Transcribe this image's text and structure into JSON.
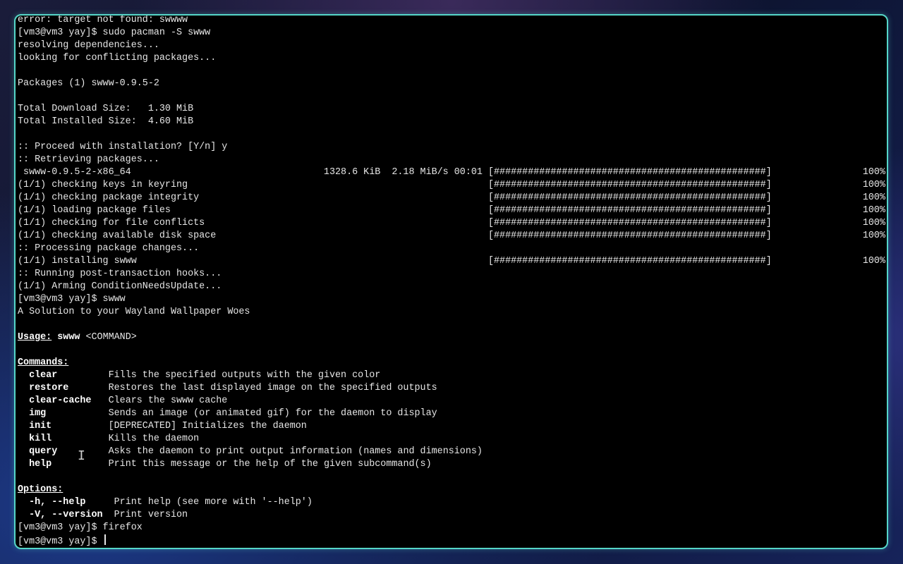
{
  "terminal": {
    "lines": [
      "error: target not found: swwww",
      "[vm3@vm3 yay]$ sudo pacman -S swww",
      "resolving dependencies...",
      "looking for conflicting packages...",
      "",
      "Packages (1) swww-0.9.5-2",
      "",
      "Total Download Size:   1.30 MiB",
      "Total Installed Size:  4.60 MiB",
      "",
      ":: Proceed with installation? [Y/n] y",
      ":: Retrieving packages...",
      " swww-0.9.5-2-x86_64                                  1328.6 KiB  2.18 MiB/s 00:01 [################################################]",
      "(1/1) checking keys in keyring                                                     [################################################]",
      "(1/1) checking package integrity                                                   [################################################]",
      "(1/1) loading package files                                                        [################################################]",
      "(1/1) checking for file conflicts                                                  [################################################]",
      "(1/1) checking available disk space                                                [################################################]",
      ":: Processing package changes...",
      "(1/1) installing swww                                                              [################################################]",
      ":: Running post-transaction hooks...",
      "(1/1) Arming ConditionNeedsUpdate...",
      "[vm3@vm3 yay]$ swww",
      "A Solution to your Wayland Wallpaper Woes",
      ""
    ],
    "progress_percent": "100%",
    "usage": {
      "label": "Usage:",
      "cmd": "swww",
      "args": "<COMMAND>"
    },
    "commands_heading": "Commands:",
    "commands": [
      {
        "name": "clear",
        "pad": "         ",
        "desc": "Fills the specified outputs with the given color"
      },
      {
        "name": "restore",
        "pad": "       ",
        "desc": "Restores the last displayed image on the specified outputs"
      },
      {
        "name": "clear-cache",
        "pad": "   ",
        "desc": "Clears the swww cache"
      },
      {
        "name": "img",
        "pad": "           ",
        "desc": "Sends an image (or animated gif) for the daemon to display"
      },
      {
        "name": "init",
        "pad": "          ",
        "desc": "[DEPRECATED] Initializes the daemon"
      },
      {
        "name": "kill",
        "pad": "          ",
        "desc": "Kills the daemon"
      },
      {
        "name": "query",
        "pad": "         ",
        "desc": "Asks the daemon to print output information (names and dimensions)"
      },
      {
        "name": "help",
        "pad": "          ",
        "desc": "Print this message or the help of the given subcommand(s)"
      }
    ],
    "options_heading": "Options:",
    "options": [
      {
        "name": "-h, --help",
        "pad": "     ",
        "desc": "Print help (see more with '--help')"
      },
      {
        "name": "-V, --version",
        "pad": "  ",
        "desc": "Print version"
      }
    ],
    "after_lines": [
      "[vm3@vm3 yay]$ firefox"
    ],
    "prompt": "[vm3@vm3 yay]$ "
  }
}
